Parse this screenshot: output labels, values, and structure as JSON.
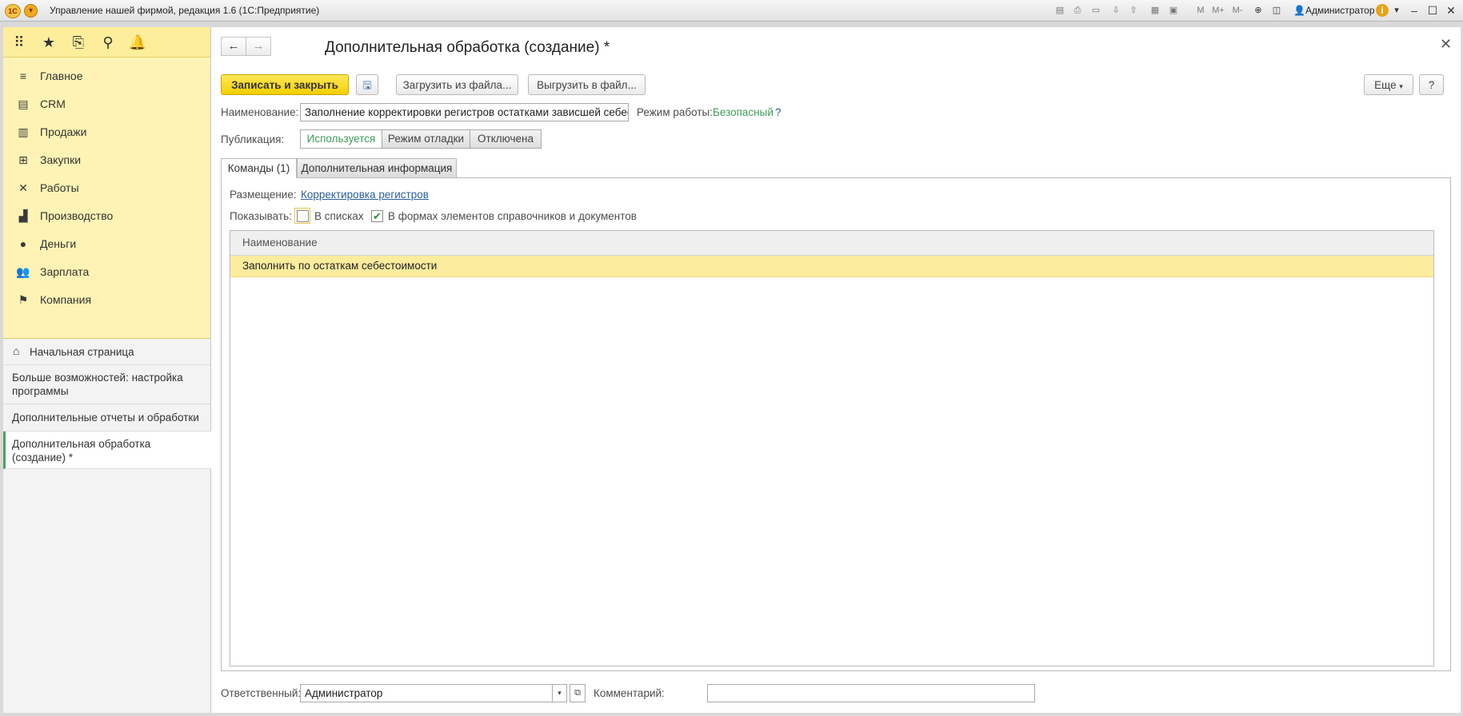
{
  "window": {
    "app_logo_text": "1С",
    "title": "Управление нашей фирмой, редакция 1.6  (1С:Предприятие)",
    "user": "Администратор",
    "toolbar_labels": [
      "M",
      "M+",
      "M-"
    ]
  },
  "sidebar": {
    "top_icons": [
      "apps-grid-icon",
      "star-icon",
      "history-icon",
      "search-icon",
      "bell-icon"
    ],
    "sections": [
      {
        "label": "Главное",
        "icon": "menu-lines-icon"
      },
      {
        "label": "CRM",
        "icon": "crm-icon"
      },
      {
        "label": "Продажи",
        "icon": "basket-icon"
      },
      {
        "label": "Закупки",
        "icon": "cart-icon"
      },
      {
        "label": "Работы",
        "icon": "tools-icon"
      },
      {
        "label": "Производство",
        "icon": "factory-icon"
      },
      {
        "label": "Деньги",
        "icon": "money-icon"
      },
      {
        "label": "Зарплата",
        "icon": "people-icon"
      },
      {
        "label": "Компания",
        "icon": "flag-icon"
      }
    ],
    "home": "Начальная страница",
    "open_windows": [
      "Больше возможностей: настройка программы",
      "Дополнительные отчеты и обработки",
      "Дополнительная обработка (создание) *"
    ]
  },
  "form": {
    "title": "Дополнительная обработка (создание) *",
    "buttons": {
      "save_close": "Записать и закрыть",
      "load_file": "Загрузить из файла...",
      "export_file": "Выгрузить в файл...",
      "more": "Еще",
      "help": "?"
    },
    "name_label": "Наименование:",
    "name_value": "Заполнение корректировки регистров остатками зависшей себестоимости",
    "mode_label": "Режим работы:",
    "mode_value": "Безопасный",
    "mode_help": "?",
    "publication_label": "Публикация:",
    "publication_options": [
      "Используется",
      "Режим отладки",
      "Отключена"
    ],
    "publication_selected": "Используется",
    "tabs": [
      "Команды (1)",
      "Дополнительная информация"
    ],
    "placement_label": "Размещение:",
    "placement_value": "Корректировка регистров",
    "show_label": "Показывать:",
    "show_in_lists": {
      "label": "В списках",
      "checked": false
    },
    "show_in_forms": {
      "label": "В формах элементов справочников и документов",
      "checked": true
    },
    "table": {
      "columns": [
        "Наименование"
      ],
      "rows": [
        "Заполнить по остаткам себестоимости"
      ]
    },
    "responsible_label": "Ответственный:",
    "responsible_value": "Администратор",
    "comment_label": "Комментарий:",
    "comment_value": ""
  },
  "colors": {
    "accent_yellow": "#f5cf00",
    "sidebar_bg": "#fef3b4",
    "selected_row": "#fbec9e",
    "green_text": "#3e9b57",
    "link": "#2a5f9e"
  }
}
